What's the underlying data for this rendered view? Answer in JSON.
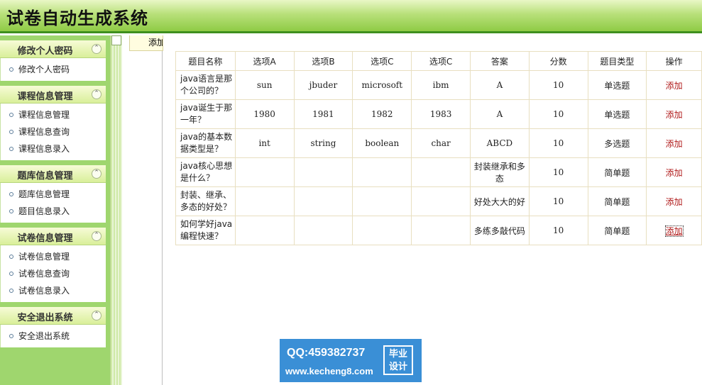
{
  "header": {
    "title": "试卷自动生成系统"
  },
  "sidebar": {
    "groups": [
      {
        "title": "修改个人密码",
        "items": [
          "修改个人密码"
        ]
      },
      {
        "title": "课程信息管理",
        "items": [
          "课程信息管理",
          "课程信息查询",
          "课程信息录入"
        ]
      },
      {
        "title": "题库信息管理",
        "items": [
          "题库信息管理",
          "题目信息录入"
        ]
      },
      {
        "title": "试卷信息管理",
        "items": [
          "试卷信息管理",
          "试卷信息查询",
          "试卷信息录入"
        ]
      },
      {
        "title": "安全退出系统",
        "items": [
          "安全退出系统"
        ]
      }
    ],
    "collapse_glyph": "⌃"
  },
  "toolbar": {
    "add_label": "添加"
  },
  "table": {
    "headers": [
      "题目名称",
      "选项A",
      "选项B",
      "选项C",
      "选项C",
      "答案",
      "分数",
      "题目类型",
      "操作"
    ],
    "rows": [
      {
        "name": "java语言是那个公司的？",
        "a": "sun",
        "b": "jbuder",
        "c": "microsoft",
        "d": "ibm",
        "answer": "A",
        "score": "10",
        "type": "单选题",
        "op": "添加"
      },
      {
        "name": "java诞生于那一年？",
        "a": "1980",
        "b": "1981",
        "c": "1982",
        "d": "1983",
        "answer": "A",
        "score": "10",
        "type": "单选题",
        "op": "添加"
      },
      {
        "name": "java的基本数据类型是？",
        "a": "int",
        "b": "string",
        "c": "boolean",
        "d": "char",
        "answer": "ABCD",
        "score": "10",
        "type": "多选题",
        "op": "添加"
      },
      {
        "name": "java核心思想是什么？",
        "a": "",
        "b": "",
        "c": "",
        "d": "",
        "answer": "封装继承和多态",
        "score": "10",
        "type": "简单题",
        "op": "添加"
      },
      {
        "name": "封装、继承、多态的好处？",
        "a": "",
        "b": "",
        "c": "",
        "d": "",
        "answer": "好处大大的好",
        "score": "10",
        "type": "简单题",
        "op": "添加"
      },
      {
        "name": "如何学好java编程快速？",
        "a": "",
        "b": "",
        "c": "",
        "d": "",
        "answer": "多练多敲代码",
        "score": "10",
        "type": "简单题",
        "op": "添加"
      }
    ]
  },
  "watermark": {
    "qq": "QQ:459382737",
    "site": "www.kecheng8.com",
    "badge_line1": "毕业",
    "badge_line2": "设计"
  }
}
